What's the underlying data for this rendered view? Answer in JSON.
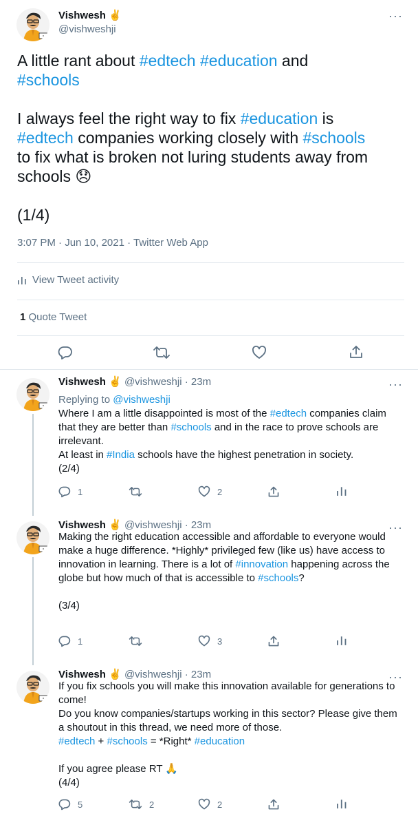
{
  "main_tweet": {
    "author_name": "Vishwesh",
    "author_emoji": "✌️",
    "author_handle": "@vishweshji",
    "more_icon": "more-dots-icon",
    "text_line1_a": "A little rant about ",
    "tag_edtech": "#edtech",
    "space": " ",
    "tag_education": "#education",
    "text_and": " and",
    "tag_schools": "#schools",
    "text_p2_a": "I always feel the right way to fix ",
    "text_p2_is": " is",
    "text_p2_b": " companies working closely with ",
    "text_p2_c": "to fix what is broken not luring students away from schools ",
    "emoji_disappointed": "😞",
    "counter": "(1/4)",
    "timestamp": "3:07 PM · Jun 10, 2021 · Twitter Web App",
    "activity_label": "View Tweet activity",
    "quote_count": "1",
    "quote_label": " Quote Tweet"
  },
  "replies": [
    {
      "name": "Vishwesh",
      "emoji": "✌️",
      "handle": "@vishweshji",
      "time": "· 23m",
      "replying_to_label": "Replying to ",
      "replying_to_handle": "@vishweshji",
      "text_a": "Where I am a little disappointed is most of the ",
      "tag_edtech": "#edtech",
      "text_b": " companies claim that they are better than ",
      "tag_schools": "#schools",
      "text_c": " and in the race to prove schools are irrelevant.",
      "text_d": "At least in ",
      "tag_india": "#India",
      "text_e": " schools have the highest penetration in society.",
      "counter": "(2/4)",
      "reply_count": "1",
      "retweet_count": "",
      "like_count": "2"
    },
    {
      "name": "Vishwesh",
      "emoji": "✌️",
      "handle": "@vishweshji",
      "time": "· 23m",
      "text_a": "Making the right education accessible and affordable to everyone would make a huge difference. *Highly* privileged few (like us) have access to innovation in learning. There is a lot of ",
      "tag_innovation": "#innovation",
      "text_b": " happening across the globe but how much of that is accessible to ",
      "tag_schools": "#schools",
      "text_c": "?",
      "counter": "(3/4)",
      "reply_count": "1",
      "retweet_count": "",
      "like_count": "3"
    },
    {
      "name": "Vishwesh",
      "emoji": "✌️",
      "handle": "@vishweshji",
      "time": "· 23m",
      "text_a": "If you fix schools you will make this innovation available for generations to come!",
      "text_b": "Do you know companies/startups working in this sector? Please give them a shoutout in this thread, we need more of those.",
      "tag_edtech": "#edtech",
      "plus": " + ",
      "tag_schools": "#schools",
      "equals": " = *Right* ",
      "tag_education": "#education",
      "text_c": "If you agree please RT ",
      "emoji_pray": "🙏",
      "counter": "(4/4)",
      "reply_count": "5",
      "retweet_count": "2",
      "like_count": "2"
    }
  ],
  "colors": {
    "link": "#1b95e0",
    "muted": "#5b7083",
    "divider": "#e1e8ed",
    "text": "#0f1419"
  }
}
